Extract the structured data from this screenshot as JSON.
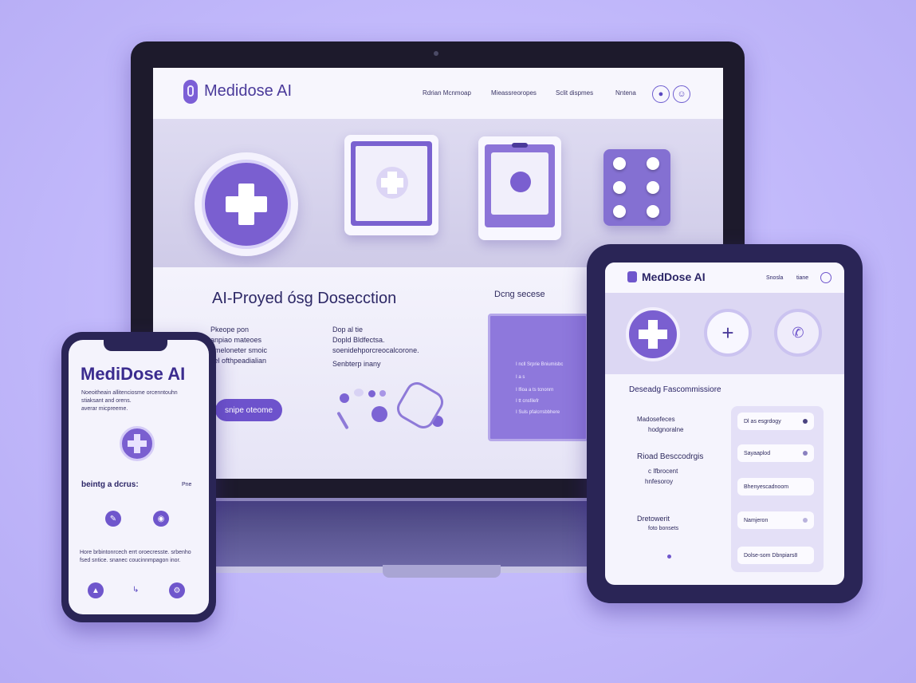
{
  "laptop": {
    "brand": "Medidose AI",
    "nav_links": [
      "Rdrian Mcnmoap",
      "Mieassreoropes",
      "Sclit dispmes",
      "Nntena"
    ],
    "hero_title": "AI-Proyed ósg Dosecction",
    "side_heading": "Dcng secese",
    "col1": [
      "Pkeope pon",
      "anpiao mateoes",
      "ameloneter smoic",
      "sel ofthpeadialian"
    ],
    "col2": [
      "Dop al tie",
      "Dopld Bldfectsa.",
      "soenidehporcreocalcorone.",
      "Senbterp inany"
    ],
    "cta": "snipe oteome",
    "panel_lines": [
      "I   ncll Srprie Bniumisbc",
      "I   a s",
      "I   lfioa a ts tcnonrn",
      "I   tt cnsfilefr",
      "I   Suls pfalcrrsbbhere"
    ]
  },
  "phone": {
    "title": "MediDose AI",
    "intro": [
      "Noeoitheain allitenciosme orcenntouhn",
      "stiaksant and orens.",
      "averar micpreeme."
    ],
    "section_label": "beintg a dcrus:",
    "section_right": "Pne",
    "footer_text": [
      "Hore brbintonrcech errt oroecresste. srbenho",
      "fsed sntice. snanec coucinnmpagon inor."
    ]
  },
  "tablet": {
    "brand": "MedDose AI",
    "header_links": [
      "Snosla",
      "tiane"
    ],
    "section_title": "Deseadg Fascommissiore",
    "rows": [
      {
        "title": "Madosefeces",
        "sub": "hodgnoralne"
      },
      {
        "title": "Rioad Besccodrgis",
        "sub": "c Ifbrocent",
        "sub2": "hnfesoroy"
      },
      {
        "title": "Dretowerit",
        "sub": "foto bonsets"
      }
    ],
    "chips": [
      "Dl as esgrdogy",
      "Sayaaplod",
      "Bhenyescadnoom",
      "Namjeron",
      "Dolse-som Dbnpiars8"
    ]
  }
}
